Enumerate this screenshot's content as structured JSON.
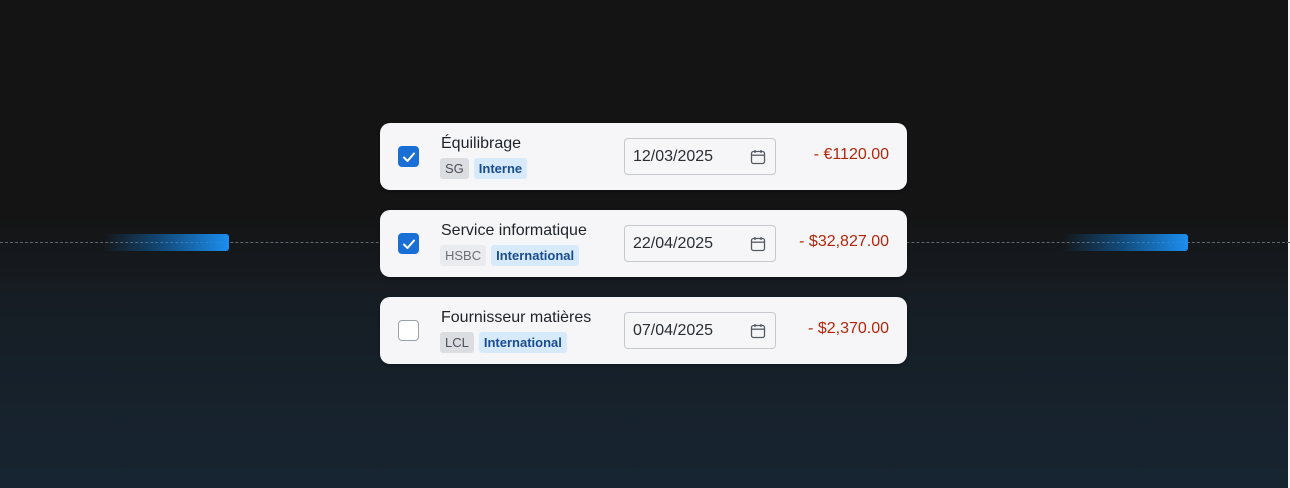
{
  "icons": {
    "calendar": "calendar-icon",
    "check": "checkmark-icon"
  },
  "colors": {
    "accent": "#1a6fd6",
    "amount": "#b4260c",
    "tag_type_bg": "#d6eafc"
  },
  "transactions": [
    {
      "checked": true,
      "name": "Équilibrage",
      "bank": "SG",
      "type": "Interne",
      "date": "12/03/2025",
      "amount": "- €1120.00"
    },
    {
      "checked": true,
      "name": "Service informatique",
      "bank": "HSBC",
      "type": "International",
      "date": "22/04/2025",
      "amount": "- $32,827.00"
    },
    {
      "checked": false,
      "name": "Fournisseur matières",
      "bank": "LCL",
      "type": "International",
      "date": "07/04/2025",
      "amount": "- $2,370.00"
    }
  ]
}
